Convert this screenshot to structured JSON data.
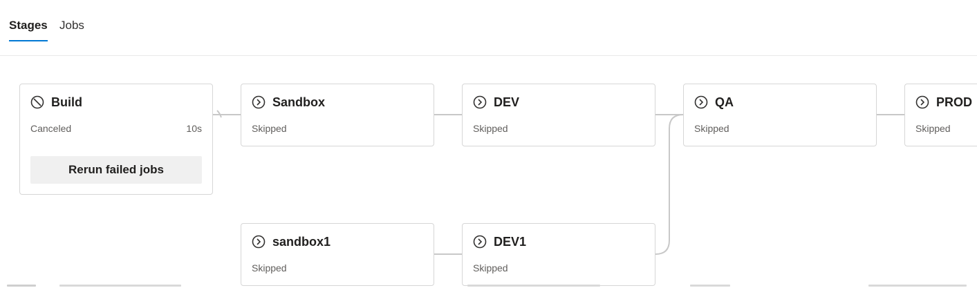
{
  "tabs": [
    {
      "label": "Stages",
      "active": true
    },
    {
      "label": "Jobs",
      "active": false
    }
  ],
  "colors": {
    "accent": "#0078d4",
    "card_border": "#d6d6d6",
    "connector": "#c8c8c8",
    "muted_text": "#605e5c"
  },
  "stages": {
    "build": {
      "name": "Build",
      "status": "Canceled",
      "duration": "10s",
      "icon": "canceled-icon",
      "action": "Rerun failed jobs"
    },
    "sandbox": {
      "name": "Sandbox",
      "status": "Skipped",
      "icon": "skipped-icon"
    },
    "dev": {
      "name": "DEV",
      "status": "Skipped",
      "icon": "skipped-icon"
    },
    "qa": {
      "name": "QA",
      "status": "Skipped",
      "icon": "skipped-icon"
    },
    "prod": {
      "name": "PROD",
      "status": "Skipped",
      "icon": "skipped-icon"
    },
    "sandbox1": {
      "name": "sandbox1",
      "status": "Skipped",
      "icon": "skipped-icon"
    },
    "dev1": {
      "name": "DEV1",
      "status": "Skipped",
      "icon": "skipped-icon"
    }
  }
}
